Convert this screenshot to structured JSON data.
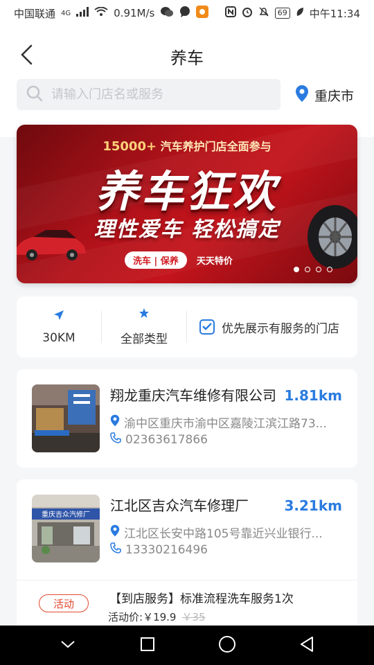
{
  "status_bar": {
    "carrier": "中国联通",
    "network": "4G",
    "speed": "0.91M/s",
    "battery": "69",
    "time": "中午11:34"
  },
  "header": {
    "title": "养车",
    "search_placeholder": "请输入门店名或服务",
    "city": "重庆市"
  },
  "banner": {
    "tagline_num": "15000+",
    "tagline_text": "汽车养护门店全面参与",
    "headline": "养车狂欢",
    "subline": "理性爱车 轻松搞定",
    "pill_a": "洗车 | 保养",
    "pill_b": "天天特价",
    "slide_count": 4,
    "active_slide": 1
  },
  "filters": {
    "distance": "30KM",
    "type": "全部类型",
    "prefer_label": "优先展示有服务的门店",
    "prefer_checked": true
  },
  "stores": [
    {
      "name": "翔龙重庆汽车维修有限公司",
      "distance": "1.81km",
      "address": "渝中区重庆市渝中区嘉陵江滨江路73...",
      "phone": "02363617866"
    },
    {
      "name": "江北区吉众汽车修理厂",
      "distance": "3.21km",
      "address": "江北区长安中路105号靠近兴业银行...",
      "phone": "13330216496",
      "sign_text": "重庆吉众汽修厂",
      "promo": {
        "tag": "活动",
        "title": "【到店服务】标准流程洗车服务1次",
        "price_label": "活动价:",
        "price": "￥19.9",
        "old_price": "￥35"
      }
    }
  ],
  "colors": {
    "accent": "#2a7be0",
    "promo_red": "#e2492f",
    "banner_red": "#c4141c"
  }
}
